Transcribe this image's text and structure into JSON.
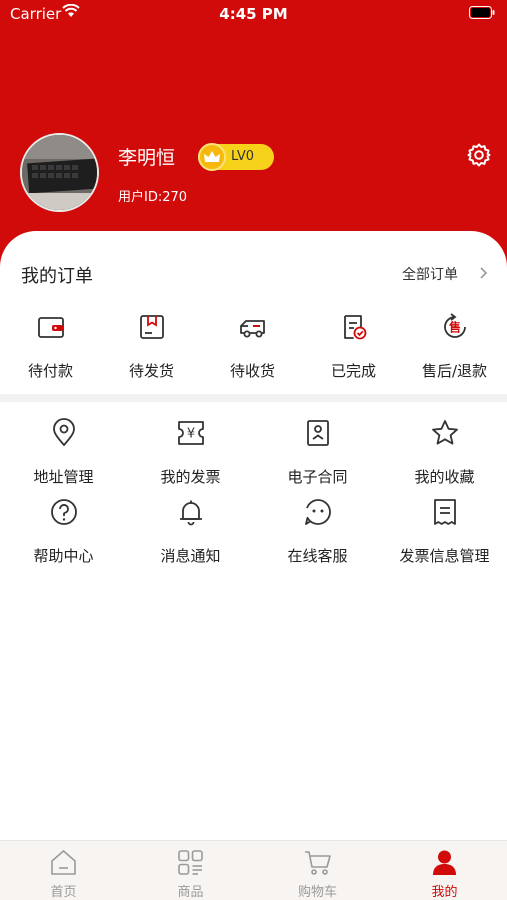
{
  "status_bar": {
    "carrier": "Carrier",
    "time": "4:45 PM"
  },
  "profile": {
    "name": "李明恒",
    "level": "LV0",
    "user_id": "用户ID:270"
  },
  "orders": {
    "title": "我的订单",
    "all_label": "全部订单",
    "items": [
      {
        "label": "待付款",
        "icon": "wallet-icon"
      },
      {
        "label": "待发货",
        "icon": "package-icon"
      },
      {
        "label": "待收货",
        "icon": "truck-icon"
      },
      {
        "label": "已完成",
        "icon": "completed-icon"
      },
      {
        "label": "售后/退款",
        "icon": "after-sale-icon"
      }
    ]
  },
  "services": [
    {
      "label": "地址管理",
      "icon": "location-pin-icon"
    },
    {
      "label": "我的发票",
      "icon": "invoice-icon"
    },
    {
      "label": "电子合同",
      "icon": "contract-icon"
    },
    {
      "label": "我的收藏",
      "icon": "star-icon"
    },
    {
      "label": "帮助中心",
      "icon": "help-icon"
    },
    {
      "label": "消息通知",
      "icon": "bell-icon"
    },
    {
      "label": "在线客服",
      "icon": "chat-face-icon"
    },
    {
      "label": "发票信息管理",
      "icon": "receipt-icon"
    }
  ],
  "tabbar": {
    "items": [
      {
        "label": "首页",
        "icon": "home-icon"
      },
      {
        "label": "商品",
        "icon": "grid-icon"
      },
      {
        "label": "购物车",
        "icon": "cart-icon"
      },
      {
        "label": "我的",
        "icon": "user-icon"
      }
    ],
    "active_index": 3,
    "active_color": "#d10a0a",
    "inactive_color": "#9a9a9a"
  },
  "colors": {
    "brand": "#d10a0a",
    "badge": "#f7d21a"
  }
}
